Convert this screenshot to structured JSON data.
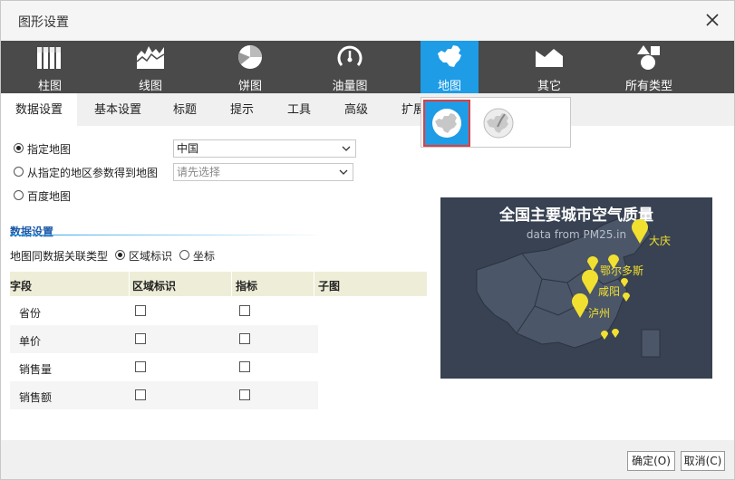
{
  "dialog": {
    "title": "图形设置"
  },
  "chart_types": [
    {
      "label": "柱图",
      "icon": "bar-chart-icon"
    },
    {
      "label": "线图",
      "icon": "line-chart-icon"
    },
    {
      "label": "饼图",
      "icon": "pie-chart-icon"
    },
    {
      "label": "油量图",
      "icon": "gauge-icon"
    },
    {
      "label": "地图",
      "icon": "china-map-icon",
      "active": true
    },
    {
      "label": "其它",
      "icon": "other-chart-icon"
    },
    {
      "label": "所有类型",
      "icon": "shapes-icon"
    }
  ],
  "tabs": [
    "数据设置",
    "基本设置",
    "标题",
    "提示",
    "工具",
    "高级",
    "扩展"
  ],
  "map_subtypes": [
    {
      "icon": "region-map-icon",
      "selected": true
    },
    {
      "icon": "point-map-icon",
      "selected": false
    }
  ],
  "map_source": {
    "option_specified": "指定地图",
    "specified_value": "中国",
    "option_from_param": "从指定的地区参数得到地图",
    "param_placeholder": "请先选择",
    "option_baidu": "百度地图"
  },
  "data_settings": {
    "section_title": "数据设置",
    "link_type_label": "地图同数据关联类型",
    "region_label": "区域标识",
    "coord_label": "坐标"
  },
  "grid": {
    "headers": [
      "字段",
      "区域标识",
      "指标",
      "子图"
    ],
    "rows": [
      {
        "field": "省份"
      },
      {
        "field": "单价"
      },
      {
        "field": "销售量"
      },
      {
        "field": "销售额"
      }
    ]
  },
  "preview": {
    "title": "全国主要城市空气质量",
    "subtitle": "data from PM25.in",
    "cities": [
      "大庆",
      "鄂尔多斯",
      "咸阳",
      "泸州"
    ],
    "bg_color": "#384252",
    "marker_color": "#f2e030"
  },
  "footer": {
    "ok": "确定(O)",
    "cancel": "取消(C)"
  },
  "colors": {
    "accent": "#1e9ce6",
    "toolbar": "#4a4a4a",
    "highlight": "#e23c3c"
  }
}
